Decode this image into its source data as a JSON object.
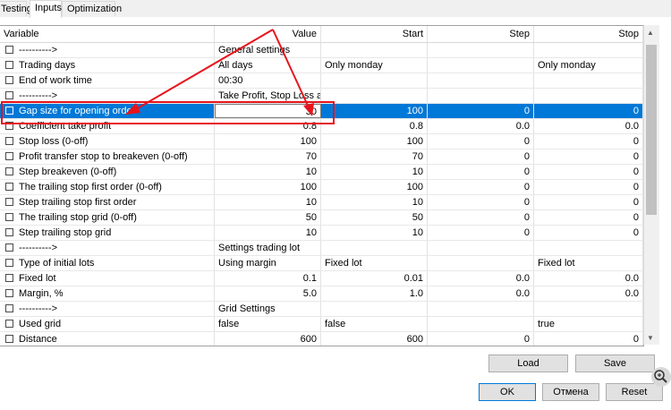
{
  "tabs": [
    "Testing",
    "Inputs",
    "Optimization"
  ],
  "columns": [
    "Variable",
    "Value",
    "Start",
    "Step",
    "Stop"
  ],
  "rows": [
    {
      "name": "---------->",
      "value": "General settings",
      "start": "",
      "step": "",
      "stop": "",
      "sep": true
    },
    {
      "name": "Trading days",
      "value": "All days",
      "start": "Only monday",
      "step": "",
      "stop": "Only monday"
    },
    {
      "name": "End of work time",
      "value": "00:30",
      "start": "",
      "step": "",
      "stop": ""
    },
    {
      "name": "---------->",
      "value": "Take Profit, Stop Loss and Gap Settings",
      "start": "",
      "step": "",
      "stop": "",
      "sep": true
    },
    {
      "name": "Gap size for opening order",
      "value": "30",
      "start": "100",
      "step": "0",
      "stop": "0",
      "selected": true
    },
    {
      "name": "Coefficient take profit",
      "value": "0.8",
      "start": "0.8",
      "step": "0.0",
      "stop": "0.0",
      "numeric": true
    },
    {
      "name": "Stop loss (0-off)",
      "value": "100",
      "start": "100",
      "step": "0",
      "stop": "0",
      "numeric": true
    },
    {
      "name": "Profit transfer stop to breakeven  (0-off)",
      "value": "70",
      "start": "70",
      "step": "0",
      "stop": "0",
      "numeric": true
    },
    {
      "name": "Step breakeven (0-off)",
      "value": "10",
      "start": "10",
      "step": "0",
      "stop": "0",
      "numeric": true
    },
    {
      "name": "The trailing stop first order (0-off)",
      "value": "100",
      "start": "100",
      "step": "0",
      "stop": "0",
      "numeric": true
    },
    {
      "name": "Step trailing stop first order",
      "value": "10",
      "start": "10",
      "step": "0",
      "stop": "0",
      "numeric": true
    },
    {
      "name": "The trailing stop grid (0-off)",
      "value": "50",
      "start": "50",
      "step": "0",
      "stop": "0",
      "numeric": true
    },
    {
      "name": "Step trailing stop grid",
      "value": "10",
      "start": "10",
      "step": "0",
      "stop": "0",
      "numeric": true
    },
    {
      "name": "---------->",
      "value": "Settings trading lot",
      "start": "",
      "step": "",
      "stop": "",
      "sep": true
    },
    {
      "name": "Type of initial lots",
      "value": "Using margin",
      "start": "Fixed lot",
      "step": "",
      "stop": "Fixed lot"
    },
    {
      "name": "Fixed lot",
      "value": "0.1",
      "start": "0.01",
      "step": "0.0",
      "stop": "0.0",
      "numeric": true
    },
    {
      "name": "Margin, %",
      "value": "5.0",
      "start": "1.0",
      "step": "0.0",
      "stop": "0.0",
      "numeric": true
    },
    {
      "name": "---------->",
      "value": "Grid Settings",
      "start": "",
      "step": "",
      "stop": "",
      "sep": true
    },
    {
      "name": "Used grid",
      "value": "false",
      "start": "false",
      "step": "",
      "stop": "true"
    },
    {
      "name": "Distance",
      "value": "600",
      "start": "600",
      "step": "0",
      "stop": "0",
      "numeric": true
    }
  ],
  "buttons": {
    "load": "Load",
    "save": "Save",
    "ok": "OK",
    "cancel": "Отмена",
    "reset": "Reset"
  },
  "colors": {
    "selection": "#0078d7",
    "annotation": "#e8141c"
  }
}
